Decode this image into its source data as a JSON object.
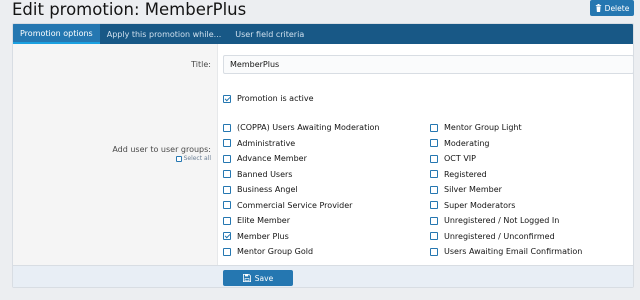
{
  "page": {
    "title": "Edit promotion: MemberPlus",
    "delete_label": "Delete"
  },
  "tabs": [
    {
      "label": "Promotion options",
      "active": true
    },
    {
      "label": "Apply this promotion while...",
      "active": false
    },
    {
      "label": "User field criteria",
      "active": false
    }
  ],
  "form": {
    "title_label": "Title:",
    "title_value": "MemberPlus",
    "active_label": "Promotion is active",
    "active_checked": true,
    "groups_label": "Add user to user groups:",
    "select_all_label": "Select all"
  },
  "groups_left": [
    {
      "label": "(COPPA) Users Awaiting Moderation",
      "checked": false
    },
    {
      "label": "Administrative",
      "checked": false
    },
    {
      "label": "Advance Member",
      "checked": false
    },
    {
      "label": "Banned Users",
      "checked": false
    },
    {
      "label": "Business Angel",
      "checked": false
    },
    {
      "label": "Commercial Service Provider",
      "checked": false
    },
    {
      "label": "Elite Member",
      "checked": false
    },
    {
      "label": "Member Plus",
      "checked": true
    },
    {
      "label": "Mentor Group Gold",
      "checked": false
    }
  ],
  "groups_right": [
    {
      "label": "Mentor Group Light",
      "checked": false
    },
    {
      "label": "Moderating",
      "checked": false
    },
    {
      "label": "OCT VIP",
      "checked": false
    },
    {
      "label": "Registered",
      "checked": false
    },
    {
      "label": "Silver Member",
      "checked": false
    },
    {
      "label": "Super Moderators",
      "checked": false
    },
    {
      "label": "Unregistered / Not Logged In",
      "checked": false
    },
    {
      "label": "Unregistered / Unconfirmed",
      "checked": false
    },
    {
      "label": "Users Awaiting Email Confirmation",
      "checked": false
    }
  ],
  "footer": {
    "save_label": "Save"
  },
  "colors": {
    "accent": "#2577b1",
    "tabbar": "#185886",
    "background": "#eceef1"
  },
  "icons": {
    "delete": "trash-icon",
    "save": "floppy-disk-icon"
  }
}
